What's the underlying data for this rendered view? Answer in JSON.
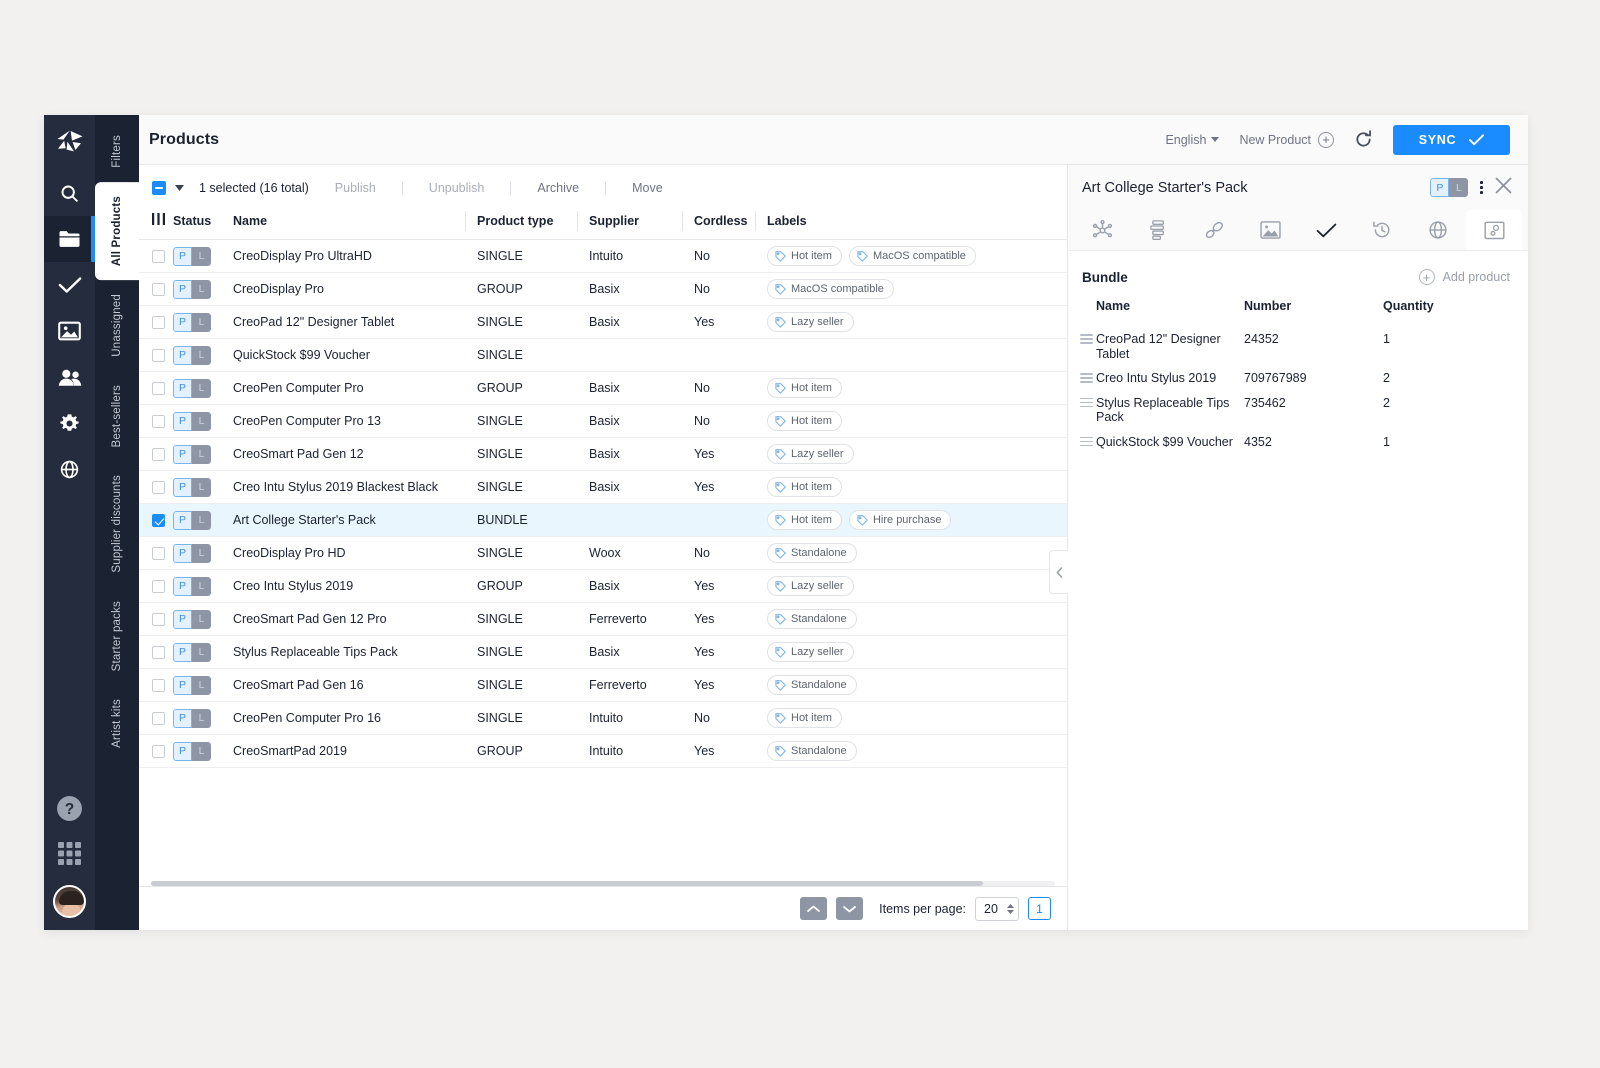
{
  "app": {
    "logo": "origami-logo-icon",
    "page_title": "Products"
  },
  "rail": {
    "items": [
      {
        "name": "search-icon",
        "label": "Search"
      },
      {
        "name": "folder-icon",
        "label": "Products",
        "active": true
      },
      {
        "name": "check-icon",
        "label": "Tasks"
      },
      {
        "name": "image-icon",
        "label": "Media"
      },
      {
        "name": "users-icon",
        "label": "Users"
      },
      {
        "name": "gear-icon",
        "label": "Settings"
      },
      {
        "name": "globe-icon",
        "label": "Languages"
      }
    ],
    "bottom": [
      {
        "name": "help-icon",
        "label": "Help"
      },
      {
        "name": "apps-grid-icon",
        "label": "Apps"
      },
      {
        "name": "avatar",
        "label": "User profile"
      }
    ]
  },
  "vtabs": [
    {
      "label": "Filters",
      "active": false
    },
    {
      "label": "All Products",
      "active": true
    },
    {
      "label": "Unassigned",
      "active": false
    },
    {
      "label": "Best-sellers",
      "active": false
    },
    {
      "label": "Supplier discounts",
      "active": false
    },
    {
      "label": "Starter packs",
      "active": false
    },
    {
      "label": "Artist kits",
      "active": false
    }
  ],
  "topbar": {
    "language": "English",
    "new_product": "New Product",
    "refresh_icon": "refresh-icon",
    "sync_label": "SYNC"
  },
  "bulkbar": {
    "selection_text": "1 selected (16 total)",
    "actions": [
      {
        "label": "Publish",
        "enabled": false
      },
      {
        "label": "Unpublish",
        "enabled": false
      },
      {
        "label": "Archive",
        "enabled": true
      },
      {
        "label": "Move",
        "enabled": true
      }
    ]
  },
  "table": {
    "columns": [
      "Status",
      "Name",
      "Product type",
      "Supplier",
      "Cordless",
      "Labels"
    ],
    "status_badge": {
      "published": "P",
      "localized": "L"
    },
    "rows": [
      {
        "selected": false,
        "name": "CreoDisplay Pro UltraHD",
        "type": "SINGLE",
        "supplier": "Intuito",
        "cordless": "No",
        "labels": [
          "Hot item",
          "MacOS compatible"
        ]
      },
      {
        "selected": false,
        "name": "CreoDisplay Pro",
        "type": "GROUP",
        "supplier": "Basix",
        "cordless": "No",
        "labels": [
          "MacOS compatible"
        ]
      },
      {
        "selected": false,
        "name": "CreoPad 12\" Designer Tablet",
        "type": "SINGLE",
        "supplier": "Basix",
        "cordless": "Yes",
        "labels": [
          "Lazy seller"
        ]
      },
      {
        "selected": false,
        "name": "QuickStock $99 Voucher",
        "type": "SINGLE",
        "supplier": "",
        "cordless": "",
        "labels": []
      },
      {
        "selected": false,
        "name": "CreoPen Computer Pro",
        "type": "GROUP",
        "supplier": "Basix",
        "cordless": "No",
        "labels": [
          "Hot item"
        ]
      },
      {
        "selected": false,
        "name": "CreoPen Computer Pro 13",
        "type": "SINGLE",
        "supplier": "Basix",
        "cordless": "No",
        "labels": [
          "Hot item"
        ]
      },
      {
        "selected": false,
        "name": "CreoSmart Pad Gen 12",
        "type": "SINGLE",
        "supplier": "Basix",
        "cordless": "Yes",
        "labels": [
          "Lazy seller"
        ]
      },
      {
        "selected": false,
        "name": "Creo Intu Stylus 2019 Blackest Black",
        "type": "SINGLE",
        "supplier": "Basix",
        "cordless": "Yes",
        "labels": [
          "Hot item"
        ]
      },
      {
        "selected": true,
        "name": "Art College Starter's Pack",
        "type": "BUNDLE",
        "supplier": "",
        "cordless": "",
        "labels": [
          "Hot item",
          "Hire purchase"
        ]
      },
      {
        "selected": false,
        "name": "CreoDisplay Pro HD",
        "type": "SINGLE",
        "supplier": "Woox",
        "cordless": "No",
        "labels": [
          "Standalone"
        ]
      },
      {
        "selected": false,
        "name": "Creo Intu Stylus 2019",
        "type": "GROUP",
        "supplier": "Basix",
        "cordless": "Yes",
        "labels": [
          "Lazy seller"
        ]
      },
      {
        "selected": false,
        "name": "CreoSmart Pad Gen 12 Pro",
        "type": "SINGLE",
        "supplier": "Ferreverto",
        "cordless": "Yes",
        "labels": [
          "Standalone"
        ]
      },
      {
        "selected": false,
        "name": "Stylus Replaceable Tips Pack",
        "type": "SINGLE",
        "supplier": "Basix",
        "cordless": "Yes",
        "labels": [
          "Lazy seller"
        ]
      },
      {
        "selected": false,
        "name": "CreoSmart Pad Gen 16",
        "type": "SINGLE",
        "supplier": "Ferreverto",
        "cordless": "Yes",
        "labels": [
          "Standalone"
        ]
      },
      {
        "selected": false,
        "name": "CreoPen Computer Pro 16",
        "type": "SINGLE",
        "supplier": "Intuito",
        "cordless": "No",
        "labels": [
          "Hot item"
        ]
      },
      {
        "selected": false,
        "name": "CreoSmartPad 2019",
        "type": "GROUP",
        "supplier": "Intuito",
        "cordless": "Yes",
        "labels": [
          "Standalone"
        ]
      }
    ]
  },
  "footer": {
    "items_per_page_label": "Items per page:",
    "items_per_page_value": "20",
    "page_number": "1",
    "up_icon": "chevron-up-icon",
    "down_icon": "chevron-down-icon"
  },
  "panel": {
    "title": "Art College Starter's Pack",
    "status_badge": {
      "published": "P",
      "localized": "L"
    },
    "tabs": [
      {
        "name": "relations-icon",
        "active": false
      },
      {
        "name": "attributes-icon",
        "active": false
      },
      {
        "name": "links-icon",
        "active": false
      },
      {
        "name": "media-icon",
        "active": false
      },
      {
        "name": "completeness-check-icon",
        "active": false
      },
      {
        "name": "history-icon",
        "active": false
      },
      {
        "name": "translations-globe-icon",
        "active": false
      },
      {
        "name": "bundle-icon",
        "active": true
      }
    ],
    "section_title": "Bundle",
    "add_product_label": "Add product",
    "bundle_columns": [
      "Name",
      "Number",
      "Quantity"
    ],
    "bundle_rows": [
      {
        "name": "CreoPad 12\" Designer Tablet",
        "number": "24352",
        "quantity": "1"
      },
      {
        "name": "Creo Intu Stylus 2019",
        "number": "709767989",
        "quantity": "2"
      },
      {
        "name": "Stylus Replaceable Tips Pack",
        "number": "735462",
        "quantity": "2"
      },
      {
        "name": "QuickStock $99 Voucher",
        "number": "4352",
        "quantity": "1"
      }
    ]
  },
  "colors": {
    "accent": "#1a8cff",
    "sidebar": "#242c3d",
    "sidebar_tabs": "#1b2231",
    "selected_row": "#eaf6fd"
  }
}
